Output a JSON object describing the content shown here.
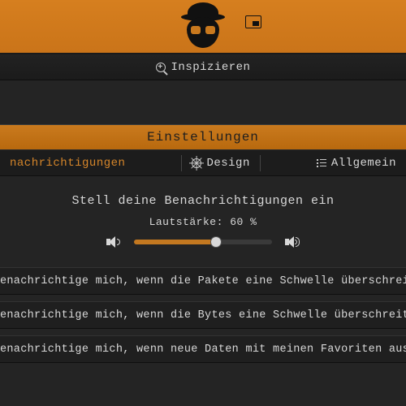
{
  "topbar": {
    "inspect_label": "Inspizieren"
  },
  "settings": {
    "title": "Einstellungen",
    "tabs": {
      "notifications": "nachrichtigungen",
      "design": "Design",
      "general": "Allgemein"
    },
    "subtitle": "Stell deine Benachrichtigungen ein",
    "volume_label": "Lautstärke: 60 %",
    "volume_value": 60,
    "options": {
      "packets": "enachrichtige mich, wenn die Pakete eine Schwelle überschreiten",
      "bytes": "enachrichtige mich, wenn die Bytes eine Schwelle überschreiten",
      "favorites": "enachrichtige mich, wenn neue Daten mit meinen Favoriten ausgetauscht werd"
    }
  }
}
